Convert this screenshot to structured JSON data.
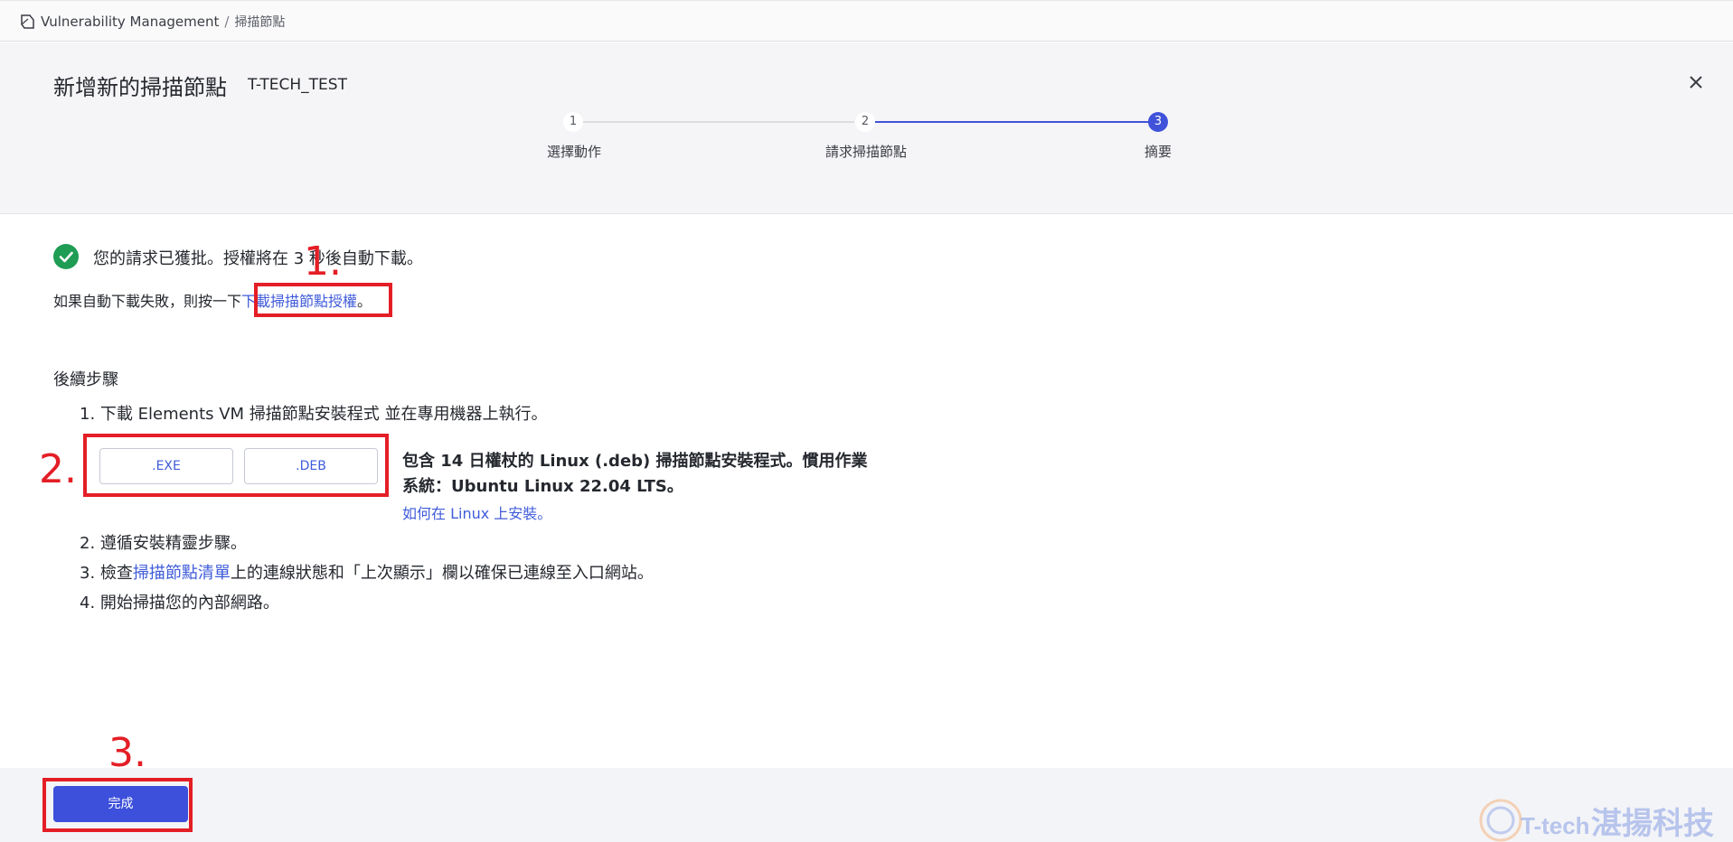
{
  "breadcrumb": {
    "root": "Vulnerability Management",
    "separator": "/",
    "current": "掃描節點"
  },
  "modal": {
    "title": "新增新的掃描節點",
    "subtitle": "T-TECH_TEST"
  },
  "stepper": {
    "steps": [
      {
        "number": "1",
        "label": "選擇動作"
      },
      {
        "number": "2",
        "label": "請求掃描節點"
      },
      {
        "number": "3",
        "label": "摘要"
      }
    ],
    "active": 3
  },
  "status": {
    "message": "您的請求已獲批。授權將在 3 秒後自動下載。",
    "fallback_prefix": "如果自動下載失敗，則按一下",
    "fallback_link": "下載掃描節點授權",
    "fallback_suffix": "。"
  },
  "next_steps": {
    "title": "後續步驟",
    "step1": "1. 下載 Elements VM 掃描節點安裝程式 並在專用機器上執行。",
    "exe_button": ".EXE",
    "deb_button": ".DEB",
    "deb_description": "包含 14 日權杖的 Linux (.deb) 掃描節點安裝程式。慣用作業系統：Ubuntu Linux 22.04 LTS。",
    "howto_link": "如何在 Linux 上安裝。",
    "step2": "2. 遵循安裝精靈步驟。",
    "step3_prefix": "3. 檢查",
    "step3_link": "掃描節點清單",
    "step3_suffix": "上的連線狀態和「上次顯示」欄以確保已連線至入口網站。",
    "step4": "4. 開始掃描您的內部網路。"
  },
  "footer": {
    "done_label": "完成"
  },
  "annotations": {
    "n1": "1.",
    "n2": "2.",
    "n3": "3.",
    "color": "#e41e26"
  },
  "watermark": {
    "logo_text": "T-tech",
    "company": "湛揚科技"
  },
  "colors": {
    "primary": "#3d50db",
    "link": "#3f5bd9",
    "success": "#1f9d55"
  }
}
